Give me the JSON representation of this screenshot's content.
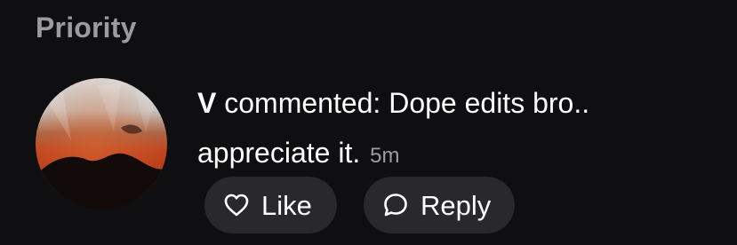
{
  "section": {
    "title": "Priority"
  },
  "notification": {
    "actor": "V",
    "message": " commented: Dope edits bro.. appreciate it.",
    "time": "5m",
    "avatar_icon": "avatar-image"
  },
  "actions": {
    "like_label": "Like",
    "like_icon": "heart-icon",
    "reply_label": "Reply",
    "reply_icon": "speech-bubble-icon"
  },
  "colors": {
    "background": "#0f0f11",
    "muted_text": "#9b9ba0",
    "pill_background": "#29292c"
  }
}
